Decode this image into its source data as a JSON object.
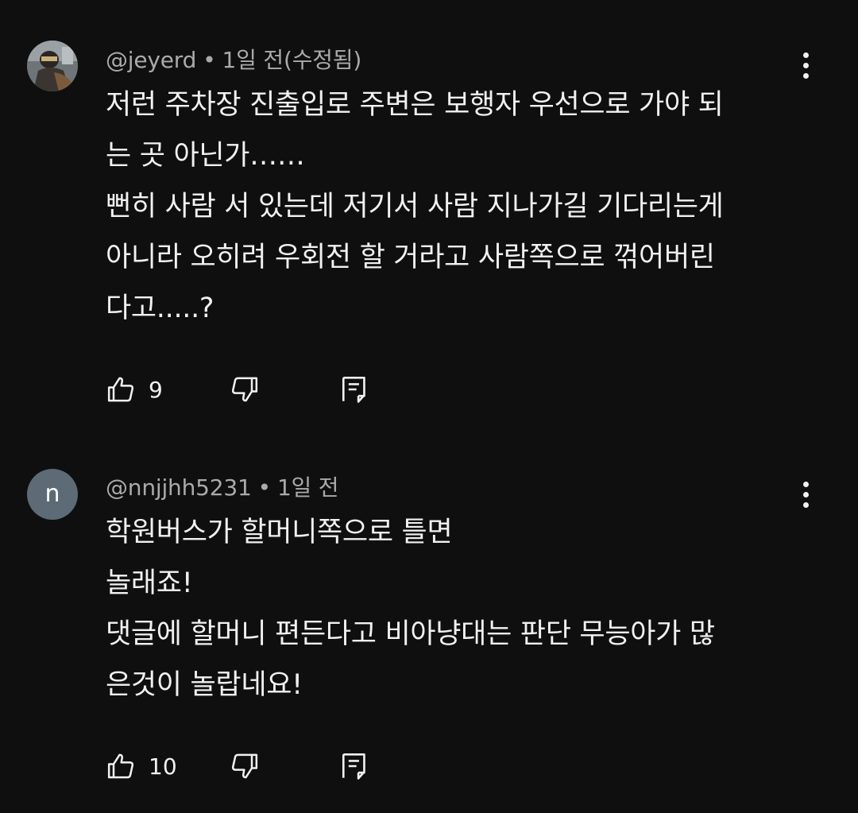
{
  "comments": [
    {
      "author": "@jeyerd",
      "time": "1일 전(수정됨)",
      "avatar": "photo",
      "lines": [
        "저런 주차장 진출입로 주변은 보행자 우선으로 가야 되",
        "는 곳 아닌가……",
        "뻔히 사람 서 있는데 저기서 사람 지나가길 기다리는게",
        "아니라 오히려 우회전 할 거라고 사람쪽으로 꺾어버린",
        "다고.....?"
      ],
      "likes": "9"
    },
    {
      "author": "@nnjjhh5231",
      "time": "1일 전",
      "avatar_letter": "n",
      "lines": [
        "학원버스가 할머니쪽으로 틀면",
        "놀래죠!",
        "댓글에 할머니 편든다고 비아냥대는 판단 무능아가 많",
        "은것이 놀랍네요!"
      ],
      "likes": "10"
    }
  ],
  "meta_separator": "•",
  "icons": {
    "like": "thumbs-up-icon",
    "dislike": "thumbs-down-icon",
    "reply": "reply-comment-icon",
    "more": "more-vertical-icon"
  },
  "colors": {
    "background": "#0f0f0f",
    "text": "#f1f1f1",
    "meta": "#aaaaaa",
    "avatar_letter_bg": "#5c6b75"
  }
}
